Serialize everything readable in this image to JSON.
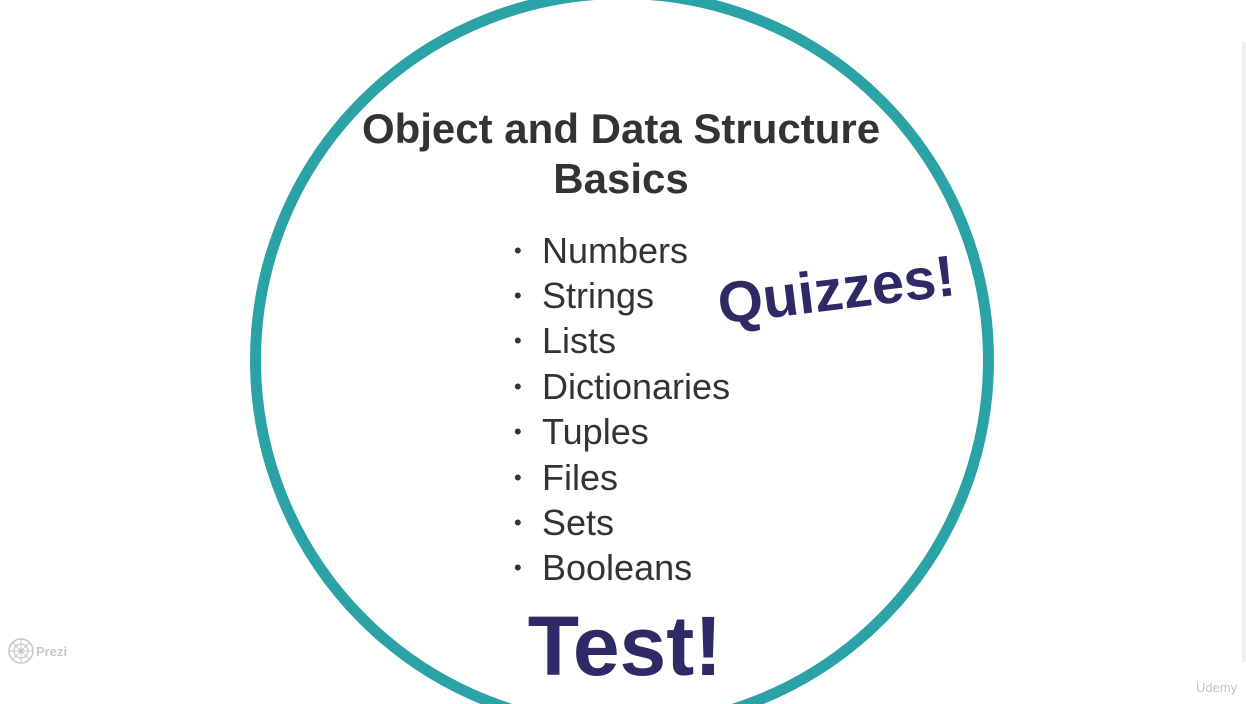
{
  "slide": {
    "title_lines": [
      "Object and Data Structure",
      "Basics"
    ],
    "topics": [
      "Numbers",
      "Strings",
      "Lists",
      "Dictionaries",
      "Tuples",
      "Files",
      "Sets",
      "Booleans"
    ],
    "bullet": "•",
    "quizzes_label": "Quizzes!",
    "test_label": "Test!"
  },
  "branding": {
    "prezi_label": "Prezi",
    "udemy_label": "Udemy"
  },
  "colors": {
    "circle_border": "#2aa2a6",
    "title_text": "#333333",
    "accent_text": "#2e2a66",
    "background": "#ffffff"
  },
  "icons": {
    "prezi_logo": "prezi-logo-icon"
  }
}
